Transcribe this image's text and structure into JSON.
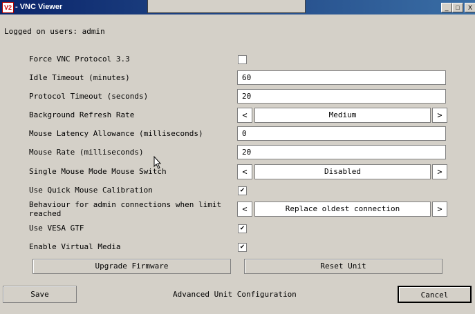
{
  "window": {
    "title": "- VNC Viewer",
    "icon_text": "V2",
    "controls": {
      "minimize": "_",
      "maximize": "□",
      "close": "X"
    }
  },
  "logged_on_users": "Logged on users: admin",
  "settings": {
    "force_vnc": {
      "label": "Force VNC Protocol 3.3",
      "checked": ""
    },
    "idle_timeout": {
      "label": "Idle Timeout (minutes)",
      "value": "60"
    },
    "protocol_timeout": {
      "label": "Protocol Timeout (seconds)",
      "value": "20"
    },
    "background_refresh": {
      "label": "Background Refresh Rate",
      "value": "Medium",
      "prev": "<",
      "next": ">"
    },
    "mouse_latency": {
      "label": "Mouse Latency Allowance (milliseconds)",
      "value": "0"
    },
    "mouse_rate": {
      "label": "Mouse Rate (milliseconds)",
      "value": "20"
    },
    "single_mouse": {
      "label": "Single Mouse Mode Mouse Switch",
      "value": "Disabled",
      "prev": "<",
      "next": ">"
    },
    "quick_calibration": {
      "label": "Use Quick Mouse Calibration",
      "checked": "✔"
    },
    "admin_behaviour": {
      "label": "Behaviour for admin connections when limit reached",
      "value": "Replace oldest connection",
      "prev": "<",
      "next": ">"
    },
    "vesa_gtf": {
      "label": "Use VESA GTF",
      "checked": "✔"
    },
    "virtual_media": {
      "label": "Enable Virtual Media",
      "checked": "✔"
    }
  },
  "actions": {
    "upgrade_firmware": "Upgrade Firmware",
    "reset_unit": "Reset Unit",
    "save": "Save",
    "cancel": "Cancel"
  },
  "footer_title": "Advanced Unit Configuration"
}
